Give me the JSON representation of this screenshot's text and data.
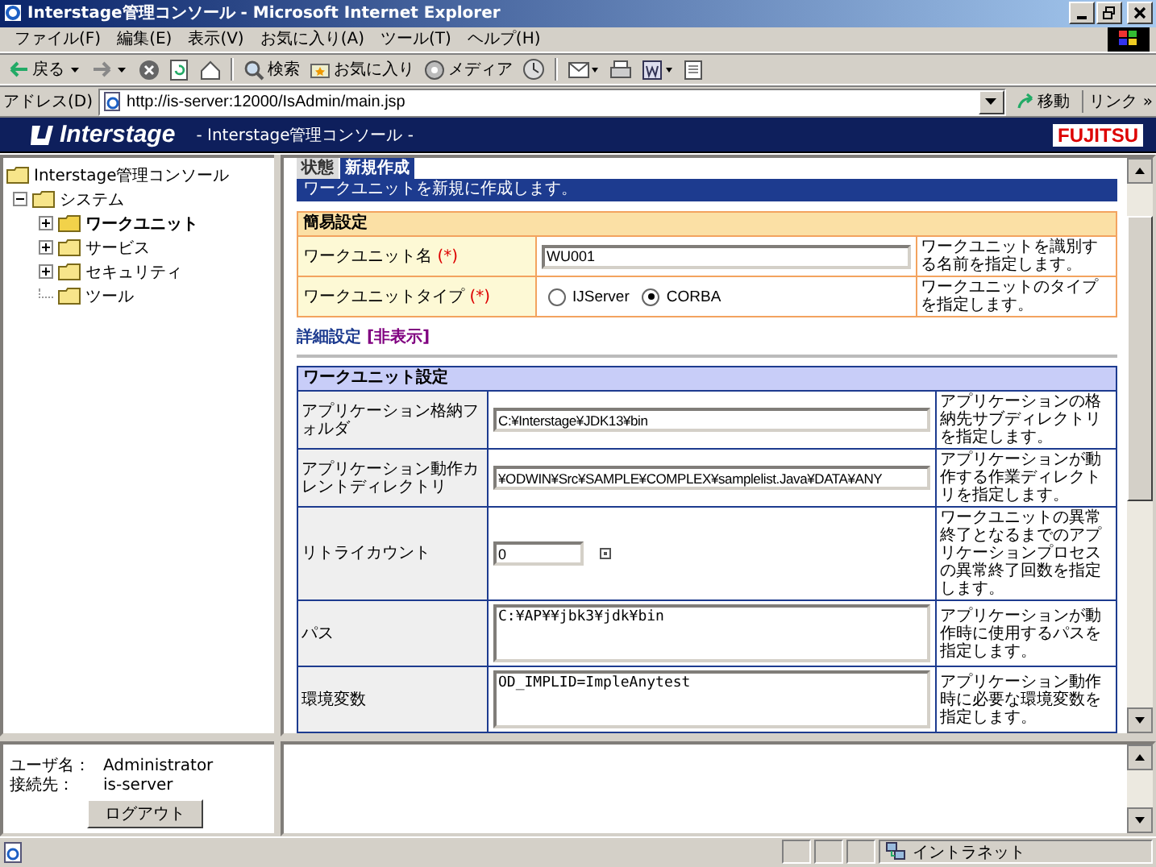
{
  "window": {
    "title": "Interstage管理コンソール - Microsoft Internet Explorer"
  },
  "menu": [
    "ファイル(F)",
    "編集(E)",
    "表示(V)",
    "お気に入り(A)",
    "ツール(T)",
    "ヘルプ(H)"
  ],
  "toolbar": [
    {
      "kind": "back",
      "label": "戻る"
    },
    {
      "kind": "forward"
    },
    {
      "kind": "stop"
    },
    {
      "kind": "refresh"
    },
    {
      "kind": "home"
    },
    {
      "kind": "search",
      "label": "検索"
    },
    {
      "kind": "favorites",
      "label": "お気に入り"
    },
    {
      "kind": "media",
      "label": "メディア"
    },
    {
      "kind": "history"
    },
    {
      "kind": "mail"
    },
    {
      "kind": "print"
    },
    {
      "kind": "edit"
    },
    {
      "kind": "discuss"
    }
  ],
  "address": {
    "label": "アドレス(D)",
    "url": "http://is-server:12000/IsAdmin/main.jsp",
    "go": "移動",
    "links": "リンク »"
  },
  "banner": {
    "logo": "Interstage",
    "title": "- Interstage管理コンソール -",
    "brand": "FUJITSU"
  },
  "tree": [
    {
      "label": "Interstage管理コンソール",
      "selected": false,
      "children": [
        {
          "label": "システム",
          "expanded": true,
          "selected": false,
          "children": [
            {
              "label": "ワークユニット",
              "expanded": false,
              "selected": true
            },
            {
              "label": "サービス",
              "expanded": false,
              "selected": false
            },
            {
              "label": "セキュリティ",
              "expanded": false,
              "selected": false
            },
            {
              "label": "ツール",
              "selected": false
            }
          ]
        }
      ]
    }
  ],
  "tabs": [
    {
      "label": "状態",
      "selected": false
    },
    {
      "label": "新規作成",
      "selected": true
    }
  ],
  "message": "ワークユニットを新規に作成します。",
  "simple": {
    "title": "簡易設定",
    "rows": [
      {
        "kind": "text",
        "label": "ワークユニット名",
        "required": "(*)",
        "value": "WU001",
        "description": "ワークユニットを識別する名前を指定します。"
      },
      {
        "kind": "radio",
        "label": "ワークユニットタイプ",
        "required": "(*)",
        "options": [
          {
            "label": "IJServer",
            "selected": false
          },
          {
            "label": "CORBA",
            "selected": true
          }
        ],
        "description": "ワークユニットのタイプを指定します。"
      }
    ]
  },
  "detail_link": {
    "label": "詳細設定",
    "action": "[非表示]"
  },
  "workunit": {
    "title": "ワークユニット設定",
    "rows": [
      {
        "kind": "text",
        "label": "アプリケーション格納フォルダ",
        "value": "C:¥Interstage¥JDK13¥bin",
        "description": "アプリケーションの格納先サブディレクトリを指定します。"
      },
      {
        "kind": "text",
        "label": "アプリケーション動作カレントディレクトリ",
        "value": "¥ODWIN¥Src¥SAMPLE¥COMPLEX¥samplelist.Java¥DATA¥ANY",
        "description": "アプリケーションが動作する作業ディレクトリを指定します。"
      },
      {
        "kind": "spin",
        "label": "リトライカウント",
        "value": "0",
        "description": "ワークユニットの異常終了となるまでのアプリケーションプロセスの異常終了回数を指定します。"
      },
      {
        "kind": "textarea",
        "label": "パス",
        "value": "C:¥AP¥¥jbk3¥jdk¥bin",
        "description": "アプリケーションが動作時に使用するパスを指定します。"
      },
      {
        "kind": "textarea",
        "label": "環境変数",
        "value": "OD_IMPLID=ImpleAnytest",
        "description": "アプリケーション動作時に必要な環境変数を指定します。"
      }
    ]
  },
  "session": {
    "user_label": "ユーザ名：",
    "user": "Administrator",
    "host_label": "接続先：",
    "host": "is-server",
    "logout": "ログアウト"
  },
  "status_bar": {
    "zone": "イントラネット"
  }
}
